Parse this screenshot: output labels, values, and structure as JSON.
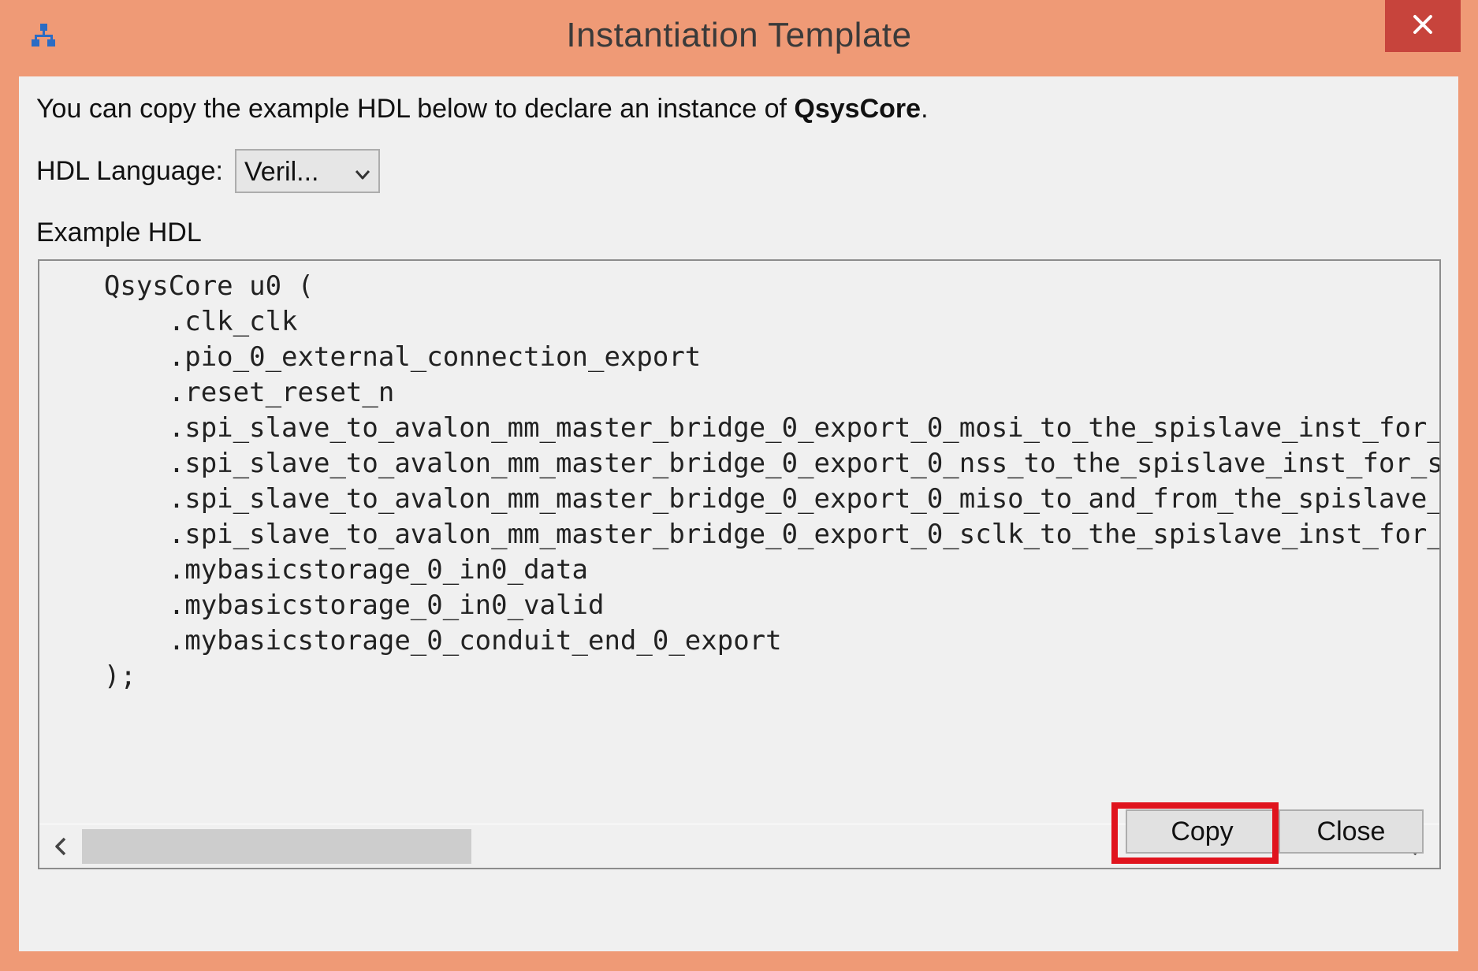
{
  "window": {
    "title": "Instantiation Template",
    "app_icon": "hierarchy-icon",
    "close_icon": "close-x-icon"
  },
  "description": {
    "prefix": "You can copy the example HDL below to declare an instance of ",
    "component": "QsysCore",
    "suffix": "."
  },
  "hdl_language": {
    "label": "HDL Language:",
    "selected": "Veril...",
    "icon": "chevron-down-icon"
  },
  "example": {
    "label": "Example HDL",
    "code_lines": [
      "    QsysCore u0 (",
      "        .clk_clk",
      "        .pio_0_external_connection_export",
      "        .reset_reset_n",
      "        .spi_slave_to_avalon_mm_master_bridge_0_export_0_mosi_to_the_spislave_inst_for_spichain",
      "        .spi_slave_to_avalon_mm_master_bridge_0_export_0_nss_to_the_spislave_inst_for_spichain",
      "        .spi_slave_to_avalon_mm_master_bridge_0_export_0_miso_to_and_from_the_spislave_inst_for",
      "        .spi_slave_to_avalon_mm_master_bridge_0_export_0_sclk_to_the_spislave_inst_for_spichain",
      "        .mybasicstorage_0_in0_data",
      "        .mybasicstorage_0_in0_valid",
      "        .mybasicstorage_0_conduit_end_0_export",
      "    );"
    ],
    "scroll_left_icon": "chevron-left-icon",
    "scroll_right_icon": "chevron-right-icon"
  },
  "buttons": {
    "copy": "Copy",
    "close": "Close"
  },
  "colors": {
    "frame": "#EF9A76",
    "close_button": "#C7443C",
    "highlight": "#E0141E",
    "client": "#F0F0F0"
  }
}
